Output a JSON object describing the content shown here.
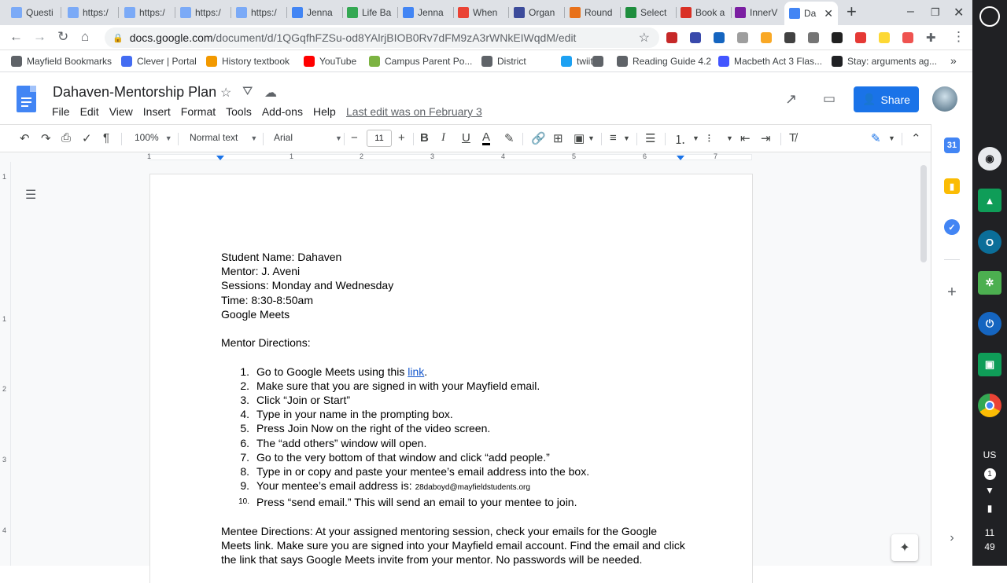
{
  "browser": {
    "tabs": [
      {
        "title": "Questi",
        "color": "#7baaf7"
      },
      {
        "title": "https:/",
        "color": "#7baaf7"
      },
      {
        "title": "https:/",
        "color": "#7baaf7"
      },
      {
        "title": "https:/",
        "color": "#7baaf7"
      },
      {
        "title": "https:/",
        "color": "#7baaf7"
      },
      {
        "title": "Jenna",
        "color": "#4285f4"
      },
      {
        "title": "Life Ba",
        "color": "#34a853"
      },
      {
        "title": "Jenna",
        "color": "#4285f4"
      },
      {
        "title": "When",
        "color": "#ea4335"
      },
      {
        "title": "Organ",
        "color": "#3c4b9b"
      },
      {
        "title": "Round",
        "color": "#e8711a"
      },
      {
        "title": "Select",
        "color": "#1e8e3e"
      },
      {
        "title": "Book a",
        "color": "#d93025"
      },
      {
        "title": "InnerV",
        "color": "#7b1fa2"
      }
    ],
    "active_tab": {
      "title": "Da",
      "close": "✕"
    },
    "new_tab": "+",
    "url": {
      "host": "docs.google.com",
      "path": "/document/d/1QGqfhFZSu-od8YAlrjBIOB0Rv7dFM9zA3rWNkEIWqdM/edit"
    },
    "bookmarks": [
      {
        "label": "Mayfield Bookmarks",
        "icon": "folder-icon",
        "color": "#5f6368"
      },
      {
        "label": "Clever | Portal",
        "icon": "clever-icon",
        "color": "#436cf2"
      },
      {
        "label": "History textbook",
        "icon": "circle-icon",
        "color": "#f29900"
      },
      {
        "label": "YouTube",
        "icon": "youtube-icon",
        "color": "#ff0000"
      },
      {
        "label": "Campus Parent Po...",
        "icon": "campus-icon",
        "color": "#7cb342"
      },
      {
        "label": "District",
        "icon": "globe-icon",
        "color": "#5f6368"
      },
      {
        "label": "twiiter",
        "icon": "twitter-icon",
        "color": "#1da1f2"
      },
      {
        "label": "",
        "icon": "globe-icon",
        "color": "#5f6368"
      },
      {
        "label": "Reading Guide 4.2",
        "icon": "globe-icon",
        "color": "#5f6368"
      },
      {
        "label": "Macbeth Act 3 Flas...",
        "icon": "quizlet-icon",
        "color": "#4255ff"
      },
      {
        "label": "Stay: arguments ag...",
        "icon": "s-icon",
        "color": "#202124"
      }
    ],
    "bookmarks_more": "»"
  },
  "docs": {
    "title": "Dahaven-Mentorship Plan",
    "menu": [
      "File",
      "Edit",
      "View",
      "Insert",
      "Format",
      "Tools",
      "Add-ons",
      "Help"
    ],
    "last_edit": "Last edit was on February 3",
    "share_label": "Share",
    "toolbar": {
      "zoom": "100%",
      "style": "Normal text",
      "font": "Arial",
      "font_size": "11"
    },
    "ruler_numbers": [
      "1",
      "1",
      "2",
      "3",
      "4",
      "5",
      "6",
      "7"
    ],
    "vruler_numbers": [
      "1",
      "1",
      "2",
      "3",
      "4"
    ]
  },
  "document": {
    "header_lines": [
      "Student Name: Dahaven",
      "Mentor: J. Aveni",
      "Sessions: Monday and Wednesday",
      "Time: 8:30-8:50am",
      "Google Meets"
    ],
    "mentor_heading": "Mentor Directions:",
    "steps": [
      {
        "num": "1.",
        "text": "Go to Google Meets using this ",
        "link": "link",
        "after": "."
      },
      {
        "num": "2.",
        "text": "Make sure that you are signed in with your Mayfield email."
      },
      {
        "num": "3.",
        "text": "Click “Join or Start”"
      },
      {
        "num": "4.",
        "text": "Type in your name in the prompting box."
      },
      {
        "num": "5.",
        "text": "Press Join Now on the right of the video screen."
      },
      {
        "num": "6.",
        "text": "The “add others” window will open."
      },
      {
        "num": "7.",
        "text": "Go to the very bottom of that window and click “add people.”"
      },
      {
        "num": "8.",
        "text": "Type in or copy and paste your mentee’s email address into the box."
      },
      {
        "num": "9.",
        "text": "Your mentee’s email address is: ",
        "email": "28daboyd@mayfieldstudents.org"
      },
      {
        "num": "10.",
        "text": "Press “send email.” This will send an email to your mentee to join."
      }
    ],
    "mentee_lines": [
      "Mentee Directions: At your assigned mentoring session, check your emails for the Google",
      "Meets link. Make sure you are signed into your Mayfield email account. Find the email and click",
      "the link that says Google Meets invite from your mentor. No passwords will be needed."
    ]
  },
  "shelf": {
    "ime": "US",
    "notif": "1",
    "time_h": "11",
    "time_m": "49"
  }
}
